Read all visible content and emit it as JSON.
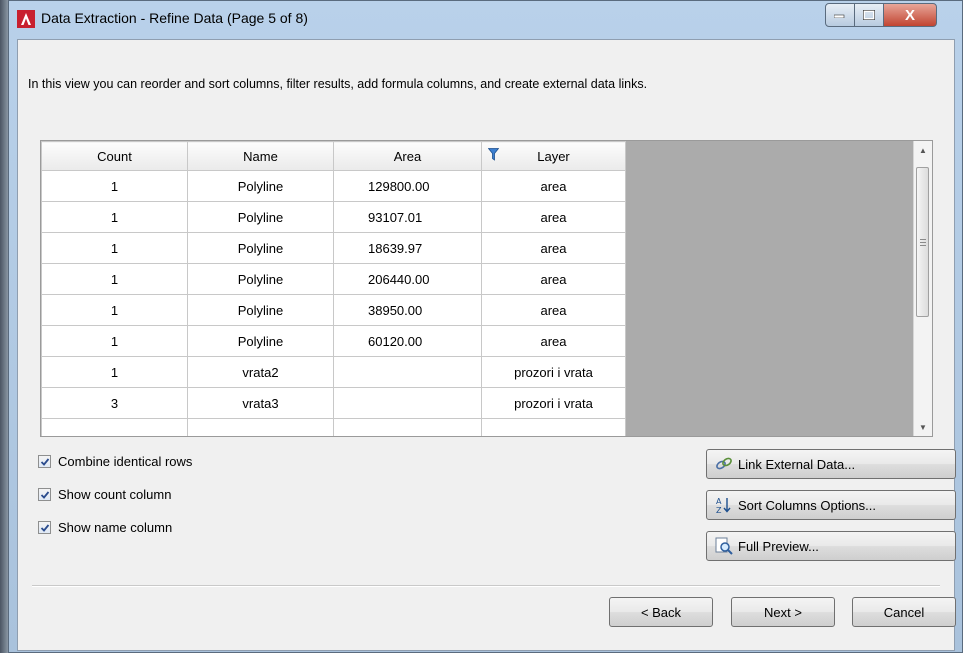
{
  "window": {
    "title": "Data Extraction - Refine Data (Page 5 of 8)",
    "close_glyph": "X"
  },
  "instructions": "In this view you can reorder and sort columns, filter results, add formula columns, and create external data links.",
  "grid": {
    "columns": [
      "Count",
      "Name",
      "Area",
      "Layer"
    ],
    "filtered_column": "Layer",
    "rows": [
      [
        "1",
        "Polyline",
        "129800.00",
        "area"
      ],
      [
        "1",
        "Polyline",
        "93107.01",
        "area"
      ],
      [
        "1",
        "Polyline",
        "18639.97",
        "area"
      ],
      [
        "1",
        "Polyline",
        "206440.00",
        "area"
      ],
      [
        "1",
        "Polyline",
        "38950.00",
        "area"
      ],
      [
        "1",
        "Polyline",
        "60120.00",
        "area"
      ],
      [
        "1",
        "vrata2",
        "",
        "prozori i vrata"
      ],
      [
        "3",
        "vrata3",
        "",
        "prozori i vrata"
      ]
    ]
  },
  "options": {
    "combine_identical_rows": {
      "label": "Combine identical rows",
      "checked": true
    },
    "show_count_column": {
      "label": "Show count column",
      "checked": true
    },
    "show_name_column": {
      "label": "Show name column",
      "checked": true
    }
  },
  "side_buttons": {
    "link_external": "Link External Data...",
    "sort_columns": "Sort Columns Options...",
    "full_preview": "Full Preview..."
  },
  "nav_buttons": {
    "back": "< Back",
    "next": "Next >",
    "cancel": "Cancel"
  },
  "icons": {
    "app": "autocad-logo-icon",
    "filter": "filter-funnel-icon",
    "link": "link-chain-icon",
    "sort": "sort-az-icon",
    "preview": "preview-magnifier-icon"
  },
  "colors": {
    "app_icon": "#c8202f",
    "close_button": "#c14431",
    "grid_empty_area": "#ababab"
  }
}
